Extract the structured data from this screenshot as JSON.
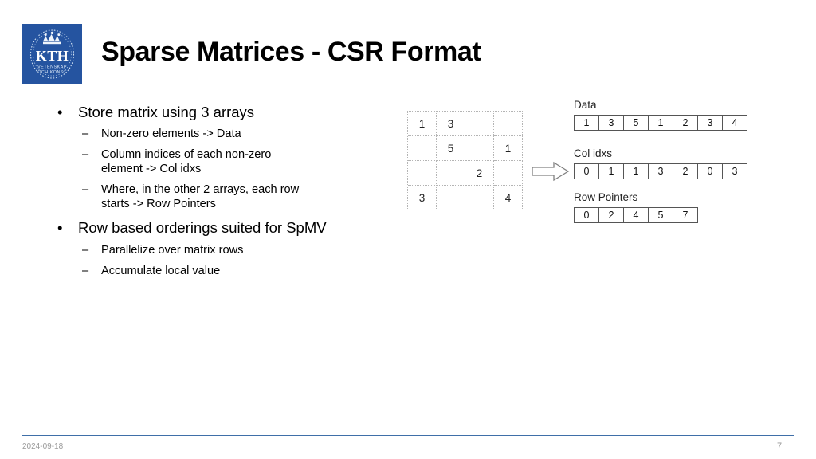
{
  "logo": {
    "name": "KTH Royal Institute of Technology",
    "acronym": "KTH",
    "motto_line1": "VETENSKAP",
    "motto_line2": "OCH KONST",
    "background_color": "#2554a0"
  },
  "title": "Sparse Matrices - CSR Format",
  "bullets": [
    {
      "level": 1,
      "marker": "•",
      "text": "Store matrix using 3 arrays"
    },
    {
      "level": 2,
      "marker": "–",
      "text": "Non-zero elements -> Data"
    },
    {
      "level": 2,
      "marker": "–",
      "line1": "Column indices of each non-zero",
      "line2": "element -> Col idxs"
    },
    {
      "level": 2,
      "marker": "–",
      "line1": "Where, in the other 2 arrays, each row",
      "line2": "starts -> Row Pointers"
    },
    {
      "level": 1,
      "marker": "•",
      "text": "Row based orderings suited for SpMV"
    },
    {
      "level": 2,
      "marker": "–",
      "text": "Parallelize over matrix rows"
    },
    {
      "level": 2,
      "marker": "–",
      "text": "Accumulate local value"
    }
  ],
  "diagram": {
    "matrix": {
      "rows": 4,
      "cols": 4,
      "cells": [
        [
          "1",
          "3",
          "",
          ""
        ],
        [
          "",
          "5",
          "",
          "1"
        ],
        [
          "",
          "",
          "2",
          ""
        ],
        [
          "3",
          "",
          "",
          "4"
        ]
      ]
    },
    "arrow": "right-block-arrow",
    "arrays": [
      {
        "id": "data",
        "label": "Data",
        "values": [
          "1",
          "3",
          "5",
          "1",
          "2",
          "3",
          "4"
        ]
      },
      {
        "id": "colidxs",
        "label": "Col idxs",
        "values": [
          "0",
          "1",
          "1",
          "3",
          "2",
          "0",
          "3"
        ]
      },
      {
        "id": "rowptrs",
        "label": "Row Pointers",
        "values": [
          "0",
          "2",
          "4",
          "5",
          "7"
        ]
      }
    ]
  },
  "footer": {
    "date": "2024-09-18",
    "page_number": "7",
    "rule_color": "#3f6fa8"
  }
}
